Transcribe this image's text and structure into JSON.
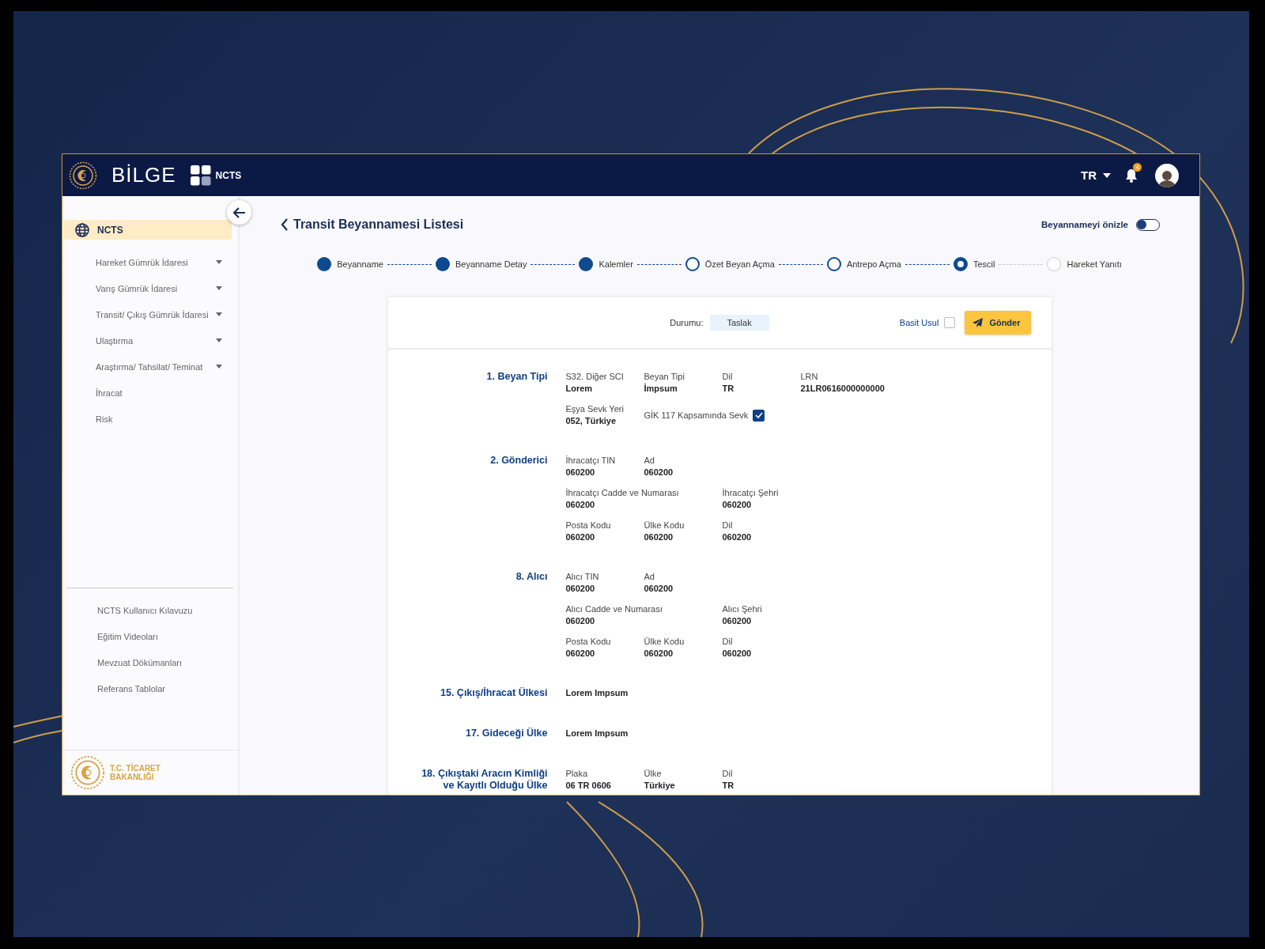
{
  "header": {
    "logo_text": "BİLGE",
    "app_label": "NCTS",
    "language": "TR",
    "notification_count": "4"
  },
  "sidebar": {
    "items": [
      {
        "kind": "module",
        "label": "NCTS",
        "selected": true
      },
      {
        "kind": "group",
        "label": "Hareket Gümrük İdaresi",
        "selected": false,
        "expanded": false
      },
      {
        "kind": "group",
        "label": "Varış Gümrük İdaresi",
        "selected": false,
        "expanded": false
      },
      {
        "kind": "group",
        "label": "Transit/ Çıkış Gümrük İdaresi",
        "selected": false,
        "expanded": false
      },
      {
        "kind": "group",
        "label": "Ulaştırma",
        "selected": false,
        "expanded": false
      },
      {
        "kind": "group",
        "label": "Araştırma/ Tahsilat/ Teminat",
        "selected": false,
        "expanded": false
      },
      {
        "kind": "link",
        "label": "İhracat",
        "selected": false
      },
      {
        "kind": "link",
        "label": "Risk",
        "selected": false
      }
    ],
    "help_links": [
      "NCTS Kullanıcı Kılavuzu",
      "Eğitim Videoları",
      "Mevzuat Dökümanları",
      "Referans Tablolar"
    ],
    "footer_logo": {
      "line_1": "T.C. TİCARET",
      "line_2": "BAKANLIĞI"
    }
  },
  "page": {
    "title": "Transit Beyannamesi Listesi",
    "preview_toggle": {
      "label": "Beyannameyi önizle",
      "on": false
    }
  },
  "steps": [
    {
      "label": "Beyanname",
      "kind": "done"
    },
    {
      "label": "Beyanname Detay",
      "kind": "done"
    },
    {
      "label": "Kalemler",
      "kind": "done"
    },
    {
      "label": "Özet Beyan Açma",
      "kind": "open"
    },
    {
      "label": "Antrepo Açma",
      "kind": "open"
    },
    {
      "label": "Tescil",
      "kind": "current"
    },
    {
      "label": "Hareket Yanıtı",
      "kind": "pending"
    }
  ],
  "card": {
    "status": {
      "label": "Durumu:",
      "value": "Taslak"
    },
    "simple_procedure": {
      "label": "Basit Usul",
      "checked": false
    },
    "send_button": "Gönder",
    "sections": [
      {
        "title": "1. Beyan Tipi",
        "rows": [
          [
            {
              "kind": "field",
              "label": "S32. Diğer SCI",
              "value": "Lorem"
            },
            {
              "kind": "field",
              "label": "Beyan Tipi",
              "value": "İmpsum"
            },
            {
              "kind": "field",
              "label": "Dil",
              "value": "TR"
            },
            {
              "kind": "field",
              "label": "LRN",
              "value": "21LR0616000000000"
            }
          ],
          [
            {
              "kind": "field",
              "label": "Eşya Sevk Yeri",
              "value": "052, Türkiye"
            },
            {
              "kind": "checkbox",
              "label": "GİK 117 Kapsamında Sevk",
              "checked": true
            }
          ]
        ]
      },
      {
        "title": "2. Gönderici",
        "rows": [
          [
            {
              "kind": "field",
              "label": "İhracatçı TIN",
              "value": "060200"
            },
            {
              "kind": "field",
              "label": "Ad",
              "value": "060200"
            }
          ],
          [
            {
              "kind": "field",
              "label": "İhracatçı Cadde ve Numarası",
              "value": "060200"
            },
            "",
            {
              "kind": "field",
              "label": "İhracatçı Şehri",
              "value": "060200"
            }
          ],
          [
            {
              "kind": "field",
              "label": "Posta Kodu",
              "value": "060200"
            },
            {
              "kind": "field",
              "label": "Ülke Kodu",
              "value": "060200"
            },
            {
              "kind": "field",
              "label": "Dil",
              "value": "060200"
            }
          ]
        ]
      },
      {
        "title": "8. Alıcı",
        "rows": [
          [
            {
              "kind": "field",
              "label": "Alıcı TIN",
              "value": "060200"
            },
            {
              "kind": "field",
              "label": "Ad",
              "value": "060200"
            }
          ],
          [
            {
              "kind": "field",
              "label": "Alıcı Cadde ve Numarası",
              "value": "060200"
            },
            "",
            {
              "kind": "field",
              "label": "Alıcı Şehri",
              "value": "060200"
            }
          ],
          [
            {
              "kind": "field",
              "label": "Posta Kodu",
              "value": "060200"
            },
            {
              "kind": "field",
              "label": "Ülke Kodu",
              "value": "060200"
            },
            {
              "kind": "field",
              "label": "Dil",
              "value": "060200"
            }
          ]
        ]
      },
      {
        "title": "15. Çıkış/İhracat Ülkesi",
        "rows": [
          [
            {
              "kind": "value",
              "value": "Lorem Impsum"
            }
          ]
        ]
      },
      {
        "title": "17. Gideceği Ülke",
        "rows": [
          [
            {
              "kind": "value",
              "value": "Lorem Impsum"
            }
          ]
        ]
      },
      {
        "title": "18. Çıkıştaki Aracın Kimliği ve Kayıtlı Olduğu Ülke",
        "rows": [
          [
            {
              "kind": "field",
              "label": "Plaka",
              "value": "06 TR 0606"
            },
            {
              "kind": "field",
              "label": "Ülke",
              "value": "Türkiye"
            },
            {
              "kind": "field",
              "label": "Dil",
              "value": "TR"
            }
          ]
        ]
      }
    ]
  }
}
